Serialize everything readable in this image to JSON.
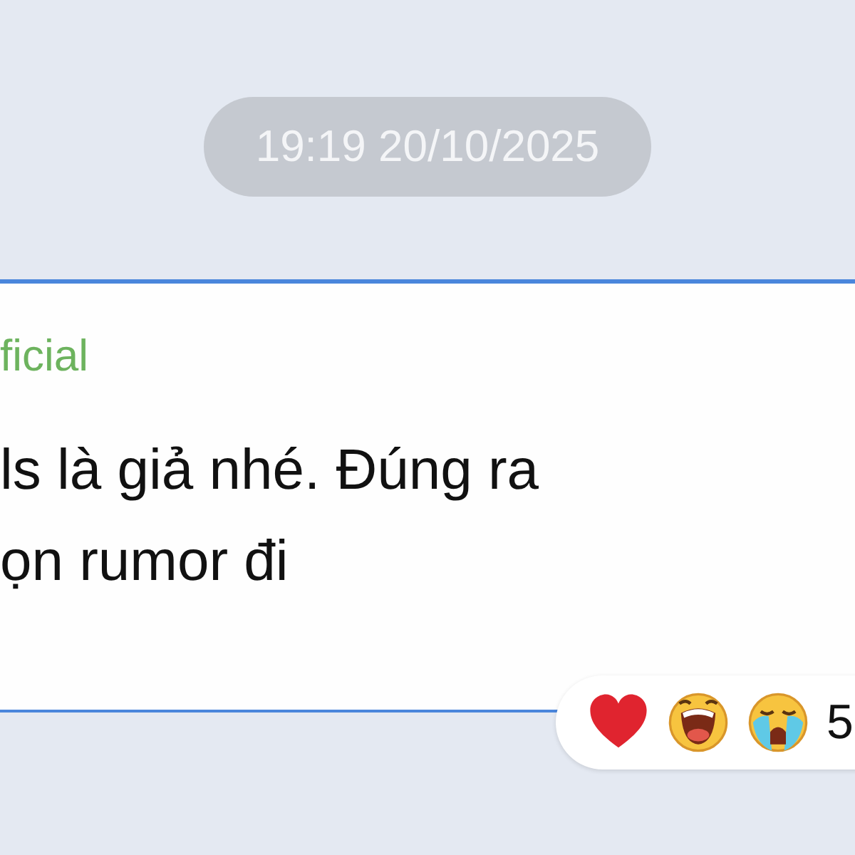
{
  "date_separator": "19:19 20/10/2025",
  "message": {
    "sender": "ficial",
    "lines": [
      "ls là giả nhé. Đúng ra",
      "ọn rumor đi"
    ]
  },
  "reactions": [
    {
      "kind": "heart"
    },
    {
      "kind": "laugh"
    },
    {
      "kind": "cry"
    }
  ],
  "reaction_count": "5"
}
